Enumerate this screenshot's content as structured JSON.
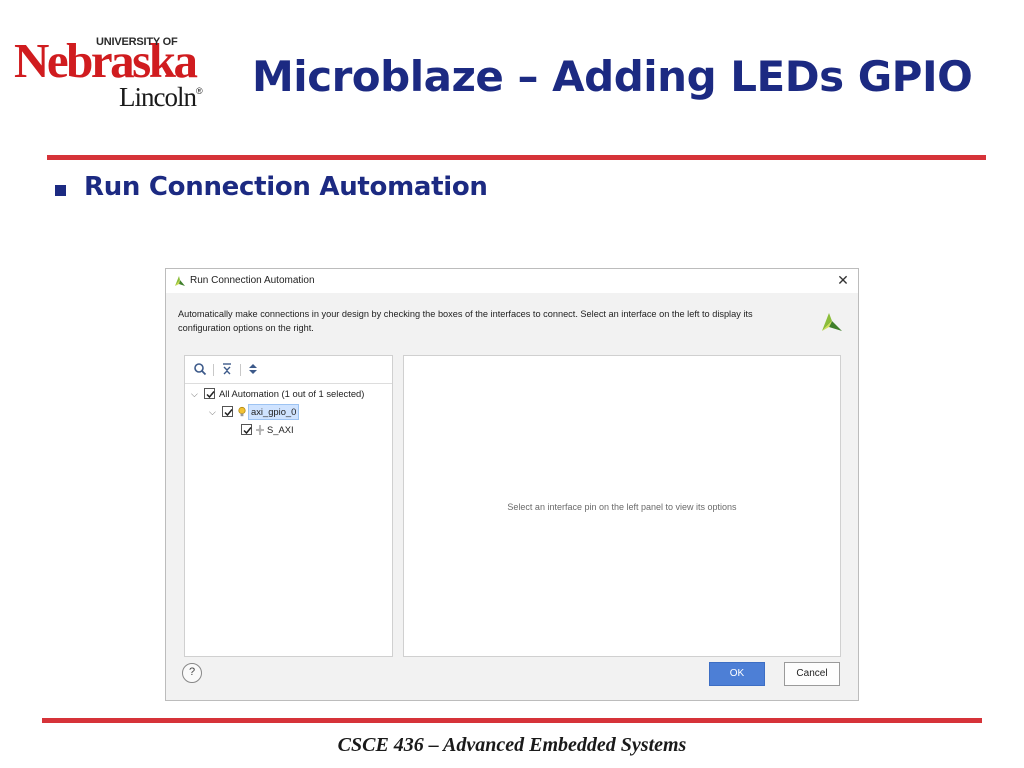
{
  "logo": {
    "university_of": "UNIVERSITY OF",
    "name": "Nebraska",
    "city": "Lincoln",
    "registered": "®"
  },
  "slide": {
    "title": "Microblaze – Adding LEDs GPIO",
    "bullet": "Run Connection Automation",
    "footer": "CSCE 436 – Advanced Embedded Systems",
    "colors": {
      "title": "#1c2a82",
      "rule": "#d63339",
      "logo_red": "#d01c1f"
    }
  },
  "dialog": {
    "title": "Run Connection Automation",
    "description": "Automatically make connections in your design by checking the boxes of the interfaces to connect. Select an interface on the left to display its configuration options on the right.",
    "toolbar_icons": [
      "search-icon",
      "collapse-all-icon",
      "expand-all-icon"
    ],
    "tree": {
      "root": {
        "label": "All Automation (1 out of 1 selected)",
        "checked": true,
        "expanded": true
      },
      "child": {
        "label": "axi_gpio_0",
        "checked": true,
        "expanded": true,
        "selected": true,
        "icon": "ip-bulb-icon"
      },
      "leaf": {
        "label": "S_AXI",
        "checked": true,
        "icon": "interface-pin-icon"
      }
    },
    "right_panel_hint": "Select an interface pin on the left panel to view its options",
    "buttons": {
      "help": "?",
      "ok": "OK",
      "cancel": "Cancel"
    },
    "close": "✕",
    "colors": {
      "ok": "#4d7fd6",
      "selection": "#cfe3ff"
    }
  }
}
